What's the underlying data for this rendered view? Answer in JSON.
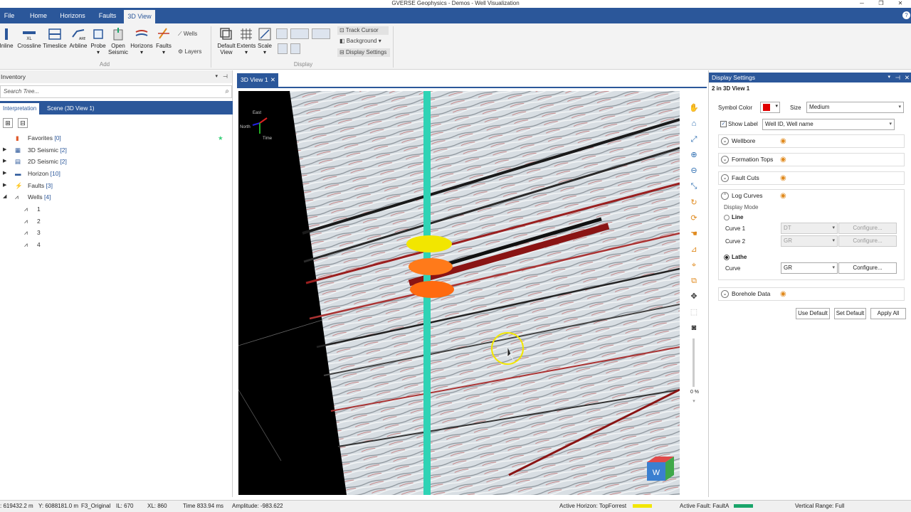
{
  "window": {
    "title": "GVERSE Geophysics - Demos - Well Visualization"
  },
  "menu": {
    "tabs": [
      "File",
      "Home",
      "Horizons",
      "Faults",
      "3D View"
    ]
  },
  "ribbon": {
    "add_buttons": [
      "Inline",
      "Crossline",
      "Timeslice",
      "Arbline",
      "Probe",
      "Open Seismic",
      "Horizons",
      "Faults"
    ],
    "wells": "Wells",
    "layers": "Layers",
    "add_group": "Add",
    "display_buttons": [
      "Default View",
      "Extents",
      "Scale"
    ],
    "track_cursor": "Track Cursor",
    "background": "Background",
    "display_settings": "Display Settings",
    "display_group": "Display"
  },
  "inventory": {
    "title": "Inventory",
    "search_placeholder": "Search Tree...",
    "tabs": [
      "Interpretation",
      "Scene (3D View 1)"
    ],
    "items": [
      {
        "label": "Favorites",
        "count": "[0]"
      },
      {
        "label": "3D Seismic",
        "count": "[2]"
      },
      {
        "label": "2D Seismic",
        "count": "[2]"
      },
      {
        "label": "Horizon",
        "count": "[10]"
      },
      {
        "label": "Faults",
        "count": "[3]"
      },
      {
        "label": "Wells",
        "count": "[4]"
      }
    ],
    "wells": [
      "1",
      "2",
      "3",
      "4"
    ]
  },
  "viewer": {
    "tab": "3D View 1",
    "compass": {
      "east": "East",
      "north": "North",
      "time": "Time"
    },
    "zoom_percent": "0 %"
  },
  "display_settings": {
    "title": "Display Settings",
    "subtitle": "2 in 3D View 1",
    "symbol_color_label": "Symbol Color",
    "symbol_color": "#e00000",
    "size_label": "Size",
    "size_value": "Medium",
    "show_label": "Show Label",
    "label_value": "Well ID, Well name",
    "sections": [
      "Wellbore",
      "Formation Tops",
      "Fault Cuts",
      "Log Curves",
      "Borehole Data"
    ],
    "display_mode_label": "Display Mode",
    "line_label": "Line",
    "curve1_label": "Curve 1",
    "curve1_value": "DT",
    "curve2_label": "Curve 2",
    "curve2_value": "GR",
    "configure": "Configure...",
    "lathe_label": "Lathe",
    "curve_label": "Curve",
    "curve_value": "GR",
    "use_default": "Use Default",
    "set_default": "Set Default",
    "apply_all": "Apply All"
  },
  "status": {
    "x": ": 619432.2 m",
    "y": "Y: 6088181.0 m",
    "volume": "F3_Original",
    "il": "IL: 670",
    "xl": "XL: 860",
    "time": "Time 833.94 ms",
    "amplitude": "Amplitude: -983.622",
    "active_horizon": "Active Horizon: TopForrest",
    "active_horizon_color": "#f2e600",
    "active_fault": "Active Fault: FaultA",
    "active_fault_color": "#1aa56a",
    "vertical_range": "Vertical Range: Full"
  }
}
